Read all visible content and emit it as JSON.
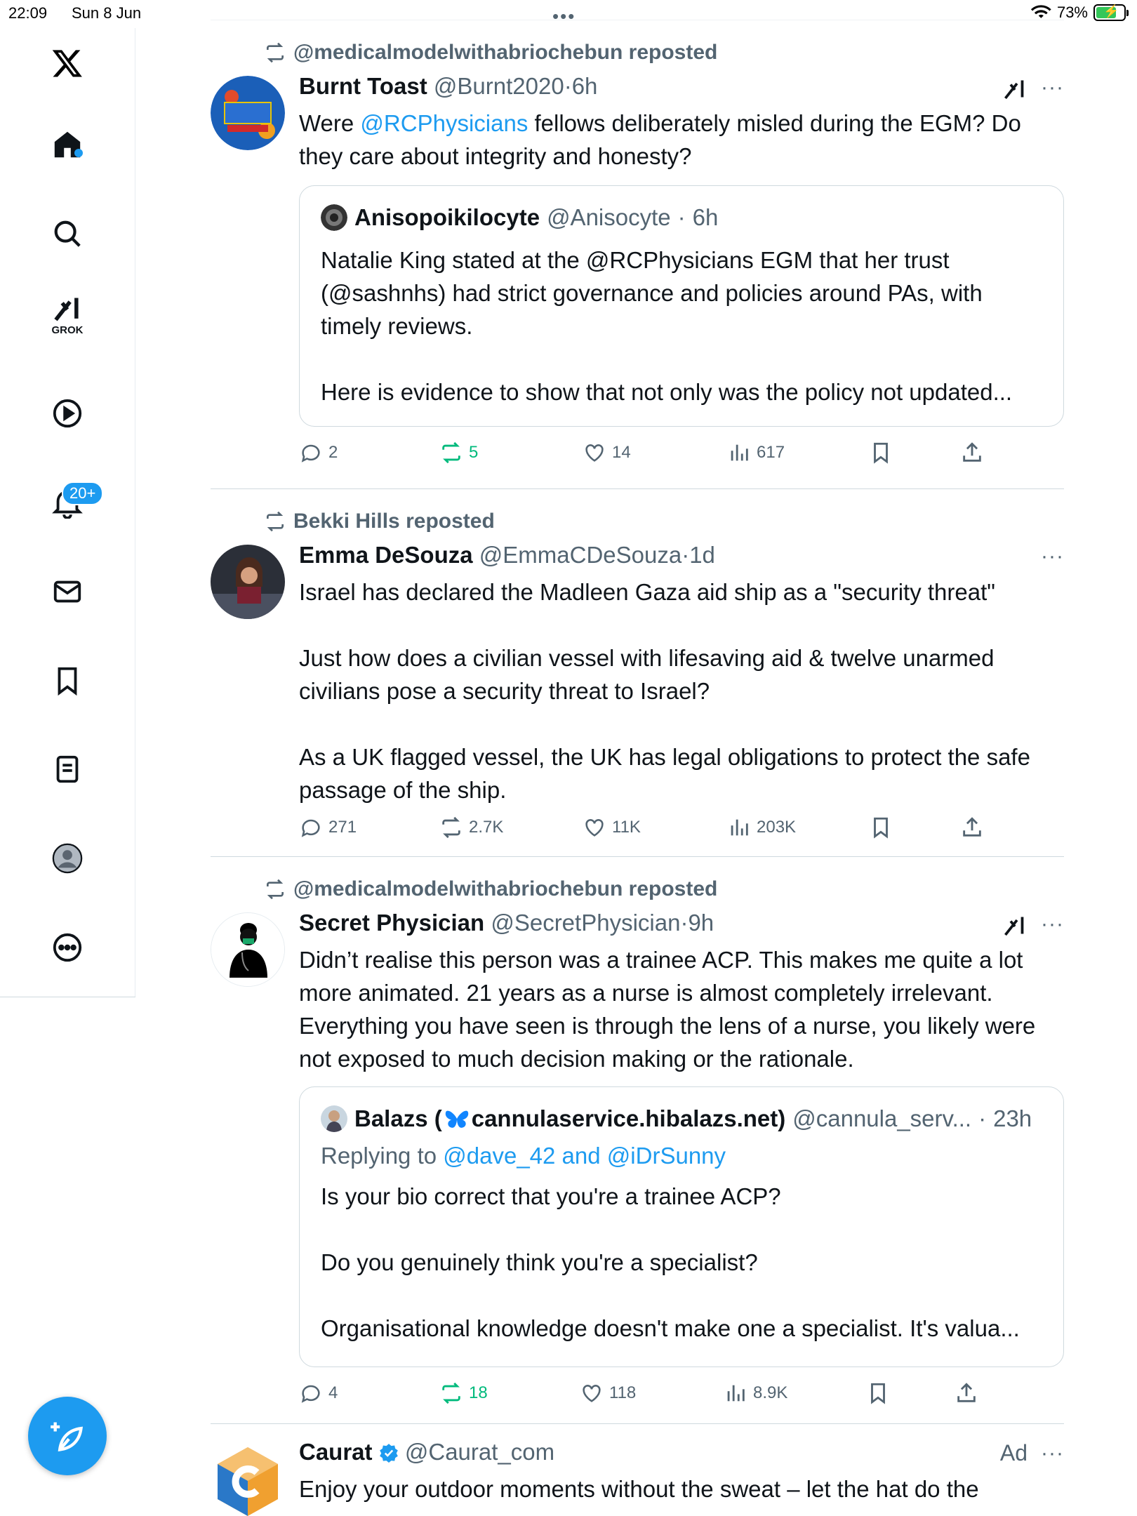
{
  "status_bar": {
    "time": "22:09",
    "date": "Sun 8 Jun",
    "battery": "73%",
    "battery_level": 0.73
  },
  "sidebar": {
    "grok_label": "GROK",
    "notifications_badge": "20+"
  },
  "posts": [
    {
      "repost_by": "@medicalmodelwithabriochebun reposted",
      "name": "Burnt Toast",
      "handle": "@Burnt2020",
      "time": "6h",
      "text_before": "Were ",
      "mention": "@RCPhysicians",
      "text_after": " fellows deliberately misled during the EGM? Do they care about integrity and honesty?",
      "quote": {
        "name": "Anisopoikilocyte",
        "handle": "@Anisocyte",
        "time": "6h",
        "text": "Natalie King stated at the @RCPhysicians EGM that her trust (@sashnhs) had strict governance and policies around PAs, with timely reviews.\n\nHere is evidence to show that not only was the policy not updated..."
      },
      "replies": "2",
      "reposts": "5",
      "likes": "14",
      "views": "617"
    },
    {
      "repost_by": "Bekki Hills reposted",
      "name": "Emma DeSouza",
      "handle": "@EmmaCDeSouza",
      "time": "1d",
      "text": "Israel has declared the Madleen Gaza aid ship as a \"security threat\"\n\nJust how does a civilian vessel with lifesaving aid & twelve unarmed civilians pose a security threat to Israel?\n\nAs a UK flagged vessel, the UK has legal obligations to protect the safe passage of the ship.",
      "replies": "271",
      "reposts": "2.7K",
      "likes": "11K",
      "views": "203K"
    },
    {
      "repost_by": "@medicalmodelwithabriochebun reposted",
      "name": "Secret Physician",
      "handle": "@SecretPhysician",
      "time": "9h",
      "text": "Didn’t realise this person was a trainee ACP. This makes me quite a lot more animated. 21 years as a nurse is almost completely irrelevant. Everything you have seen is through the lens of a nurse, you likely were not exposed to much decision making or the rationale.",
      "quote": {
        "name_prefix": "Balazs (",
        "name_suffix": "cannulaservice.hibalazs.net)",
        "handle": "@cannula_serv...",
        "time": "23h",
        "replying_label": "Replying to ",
        "replying_to_1": "@dave_42",
        "replying_and": " and ",
        "replying_to_2": "@iDrSunny",
        "text": "Is your bio correct that you're a trainee ACP?\n\nDo you genuinely think you're a specialist?\n\nOrganisational knowledge doesn't make one a specialist. It's valua..."
      },
      "replies": "4",
      "reposts": "18",
      "likes": "118",
      "views": "8.9K"
    },
    {
      "name": "Caurat",
      "handle": "@Caurat_com",
      "ad_label": "Ad",
      "text": "Enjoy your outdoor moments without the sweat – let the hat do the"
    }
  ],
  "colors": {
    "accent": "#1d9bf0",
    "repost_green": "#00ba7c",
    "muted": "#536471"
  },
  "icons": [
    "x-logo-icon",
    "home-icon",
    "search-icon",
    "grok-icon",
    "play-icon",
    "bell-icon",
    "mail-icon",
    "bookmark-icon",
    "list-icon",
    "avatar-icon",
    "more-circle-icon",
    "compose-icon",
    "reply-icon",
    "repost-icon",
    "like-icon",
    "views-icon",
    "share-icon",
    "verified-icon"
  ]
}
